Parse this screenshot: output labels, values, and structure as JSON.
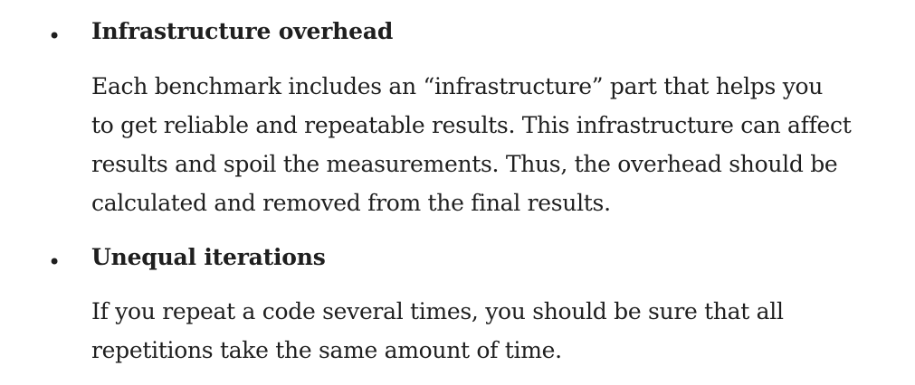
{
  "items": [
    {
      "bullet": "•",
      "heading": "Infrastructure overhead",
      "lines": [
        "Each benchmark includes an “infrastructure” part that helps you",
        "to get reliable and repeatable results. This infrastructure can affect",
        "results and spoil the measurements. Thus, the overhead should be",
        "calculated and removed from the final results."
      ]
    },
    {
      "bullet": "•",
      "heading": "Unequal iterations",
      "lines": [
        "If you repeat a code several times, you should be sure that all",
        "repetitions take the same amount of time."
      ]
    }
  ]
}
